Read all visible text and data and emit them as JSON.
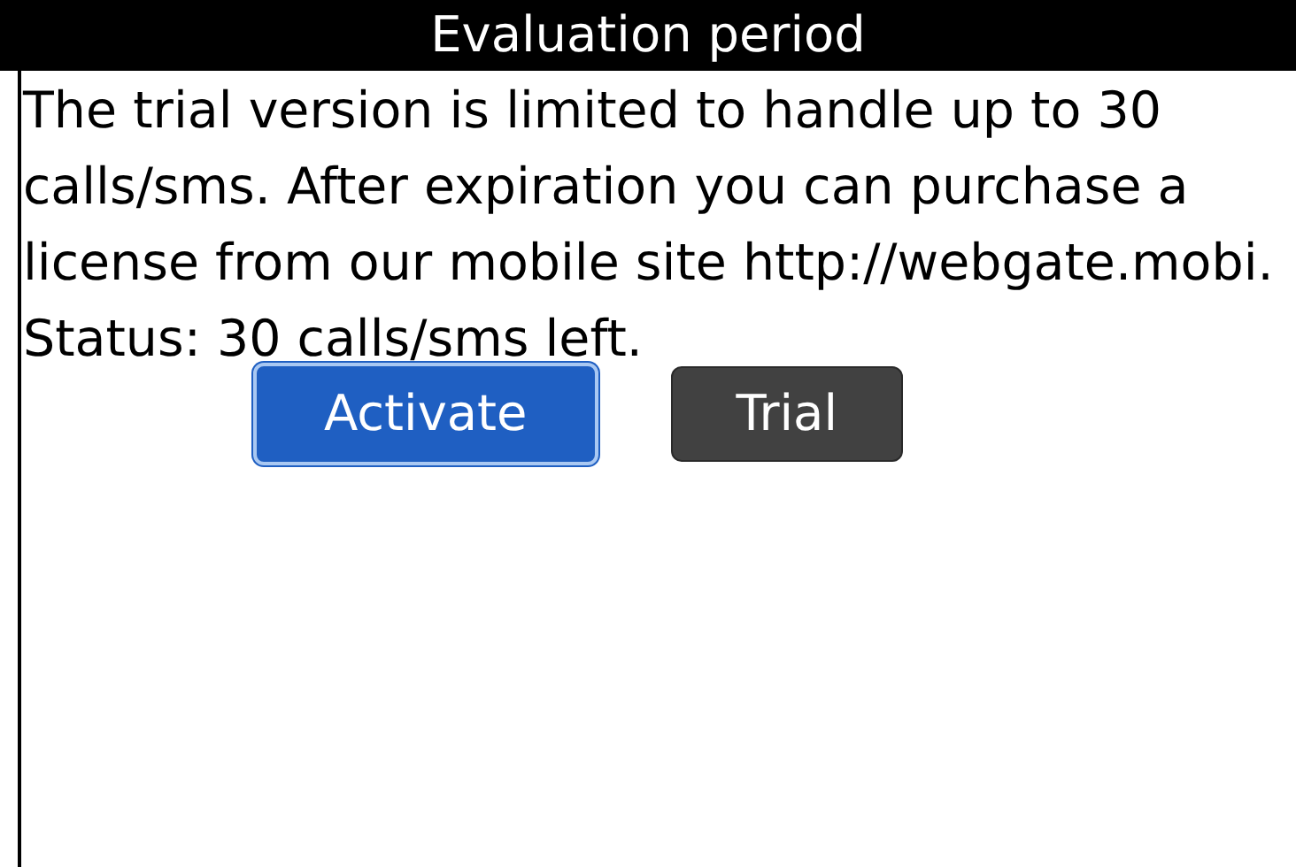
{
  "window": {
    "title": "Evaluation period"
  },
  "message": "The trial version is limited to handle up to 30 calls/sms. After expiration you can purchase a license from our mobile site http://webgate.mobi.",
  "status": "Status: 30 calls/sms left.",
  "buttons": [
    {
      "label": "Activate",
      "selected": true
    },
    {
      "label": "Trial",
      "selected": false
    }
  ]
}
